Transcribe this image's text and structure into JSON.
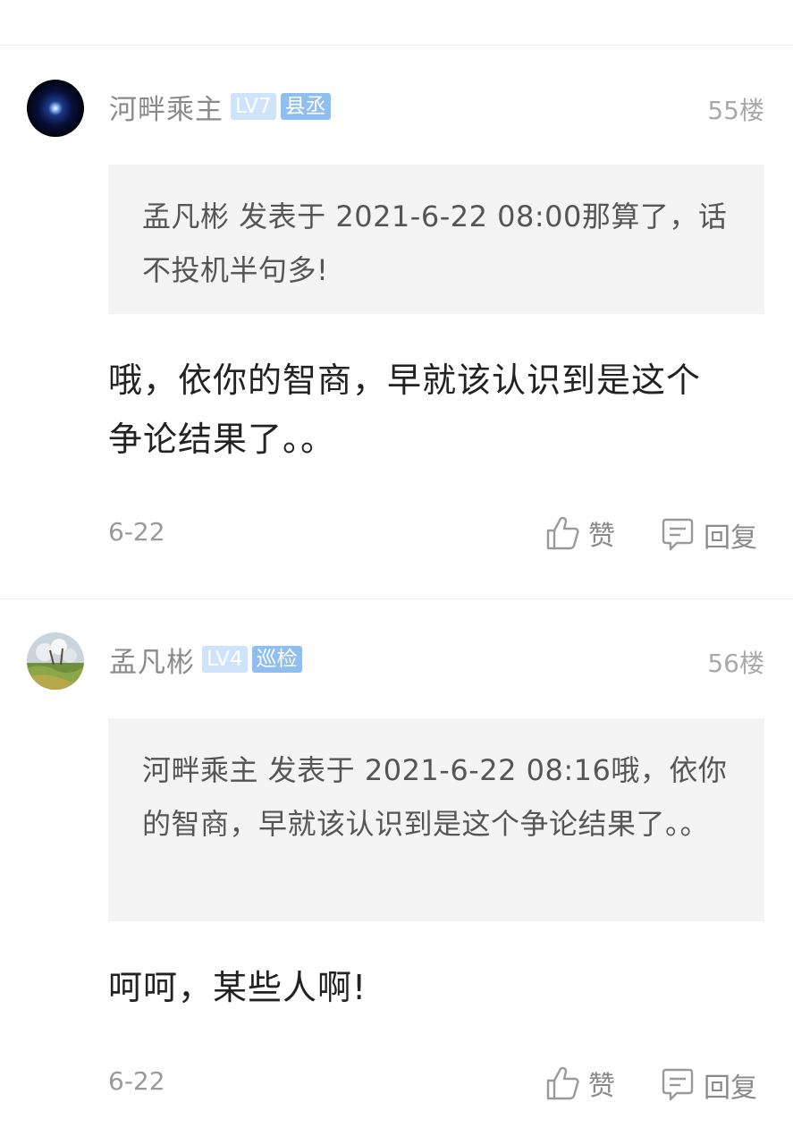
{
  "posts": [
    {
      "author": "河畔乘主",
      "level": "LV7",
      "title": "县丞",
      "floor": "55楼",
      "quote": "孟凡彬 发表于 2021-6-22 08:00那算了，话不投机半句多!",
      "content": "哦，依你的智商，早就该认识到是这个争论结果了。。",
      "date": "6-22",
      "like_label": "赞",
      "reply_label": "回复"
    },
    {
      "author": "孟凡彬",
      "level": "LV4",
      "title": "巡检",
      "floor": "56楼",
      "quote": "河畔乘主 发表于 2021-6-22 08:16哦，依你的智商，早就该认识到是这个争论结果了。。",
      "content": "呵呵，某些人啊!",
      "date": "6-22",
      "like_label": "赞",
      "reply_label": "回复"
    }
  ],
  "icons": {
    "like": "thumbs-up-icon",
    "reply": "comment-icon"
  },
  "colors": {
    "level_badge": "#cfe3fb",
    "title_badge": "#8fbef2",
    "quote_bg": "#f4f4f4"
  }
}
